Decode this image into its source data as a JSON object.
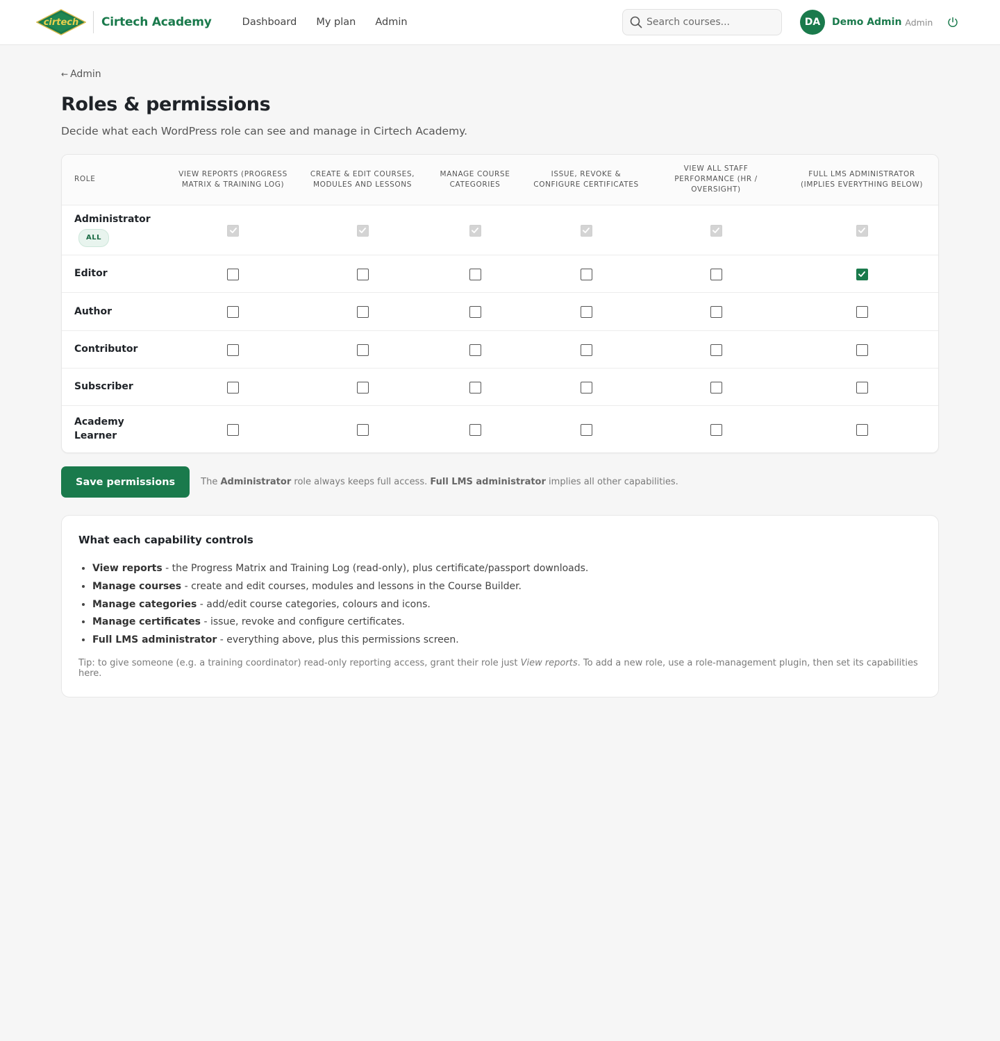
{
  "header": {
    "logo_text": "cirtech",
    "brand": "Cirtech Academy",
    "nav": [
      "Dashboard",
      "My plan",
      "Admin"
    ],
    "search_placeholder": "Search courses...",
    "user": {
      "initials": "DA",
      "name": "Demo Admin",
      "role": "Admin"
    }
  },
  "page": {
    "back_label": "Admin",
    "title": "Roles & permissions",
    "subtitle": "Decide what each WordPress role can see and manage in Cirtech Academy."
  },
  "table": {
    "columns": [
      "Role",
      "View reports (progress matrix & training log)",
      "Create & edit courses, modules and lessons",
      "Manage course categories",
      "Issue, revoke & configure certificates",
      "View all staff performance (HR / oversight)",
      "Full LMS administrator (implies everything below)"
    ],
    "rows": [
      {
        "role": "Administrator",
        "badge": "ALL",
        "locked": true,
        "values": [
          true,
          true,
          true,
          true,
          true,
          true
        ]
      },
      {
        "role": "Editor",
        "values": [
          false,
          false,
          false,
          false,
          false,
          true
        ]
      },
      {
        "role": "Author",
        "values": [
          false,
          false,
          false,
          false,
          false,
          false
        ]
      },
      {
        "role": "Contributor",
        "values": [
          false,
          false,
          false,
          false,
          false,
          false
        ]
      },
      {
        "role": "Subscriber",
        "values": [
          false,
          false,
          false,
          false,
          false,
          false
        ]
      },
      {
        "role": "Academy Learner",
        "values": [
          false,
          false,
          false,
          false,
          false,
          false
        ]
      }
    ]
  },
  "actions": {
    "save_label": "Save permissions",
    "note_prefix": "The ",
    "note_bold1": "Administrator",
    "note_mid": " role always keeps full access. ",
    "note_bold2": "Full LMS administrator",
    "note_suffix": " implies all other capabilities."
  },
  "info": {
    "title": "What each capability controls",
    "items": [
      {
        "term": "View reports",
        "desc": " - the Progress Matrix and Training Log (read-only), plus certificate/passport downloads."
      },
      {
        "term": "Manage courses",
        "desc": " - create and edit courses, modules and lessons in the Course Builder."
      },
      {
        "term": "Manage categories",
        "desc": " - add/edit course categories, colours and icons."
      },
      {
        "term": "Manage certificates",
        "desc": " - issue, revoke and configure certificates."
      },
      {
        "term": "Full LMS administrator",
        "desc": " - everything above, plus this permissions screen."
      }
    ],
    "tip_prefix": "Tip: to give someone (e.g. a training coordinator) read-only reporting access, grant their role just ",
    "tip_em": "View reports",
    "tip_suffix": ". To add a new role, use a role-management plugin, then set its capabilities here."
  },
  "colors": {
    "brand": "#1a7a4c",
    "background": "#f6f6f6"
  }
}
